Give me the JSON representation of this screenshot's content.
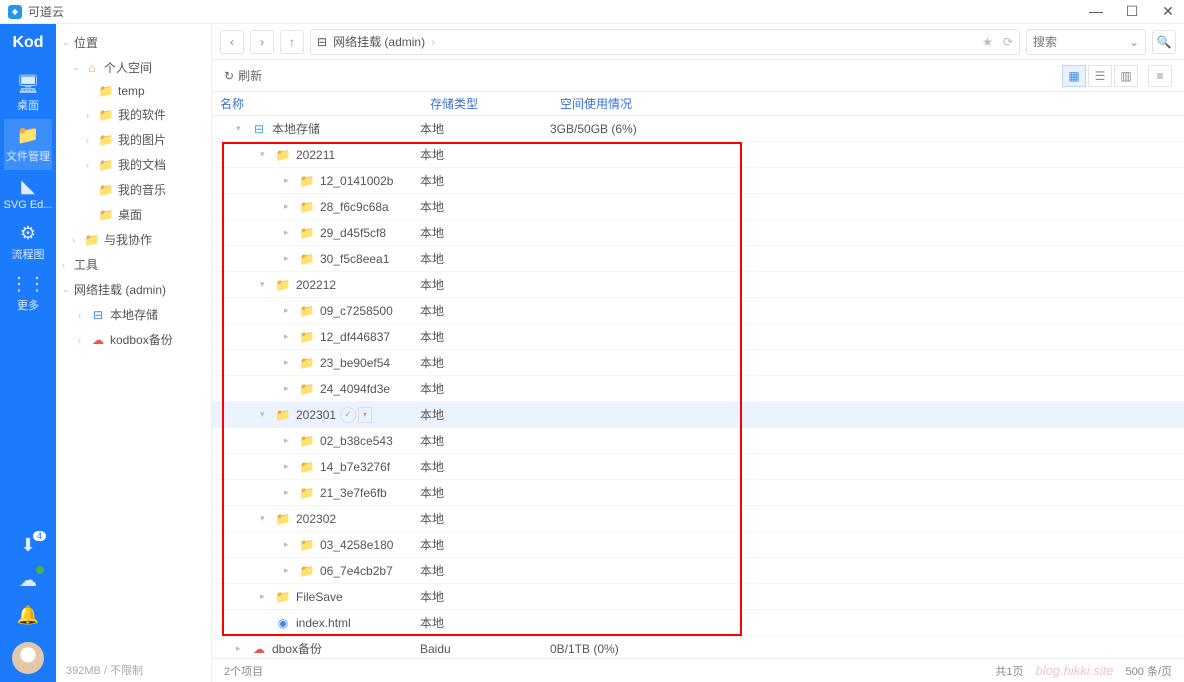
{
  "titlebar": {
    "title": "可道云"
  },
  "rail": {
    "logo": "Kod",
    "items": [
      {
        "label": "桌面",
        "icon": "🖥"
      },
      {
        "label": "文件管理",
        "icon": "📁",
        "active": true
      },
      {
        "label": "SVG Ed...",
        "icon": "◣"
      },
      {
        "label": "流程图",
        "icon": "⚙"
      },
      {
        "label": "更多",
        "icon": "⋮⋮"
      }
    ],
    "download_badge": "4"
  },
  "tree": {
    "root": "位置",
    "personal": "个人空间",
    "personal_items": [
      {
        "label": "temp"
      },
      {
        "label": "我的软件",
        "expandable": true
      },
      {
        "label": "我的图片",
        "expandable": true
      },
      {
        "label": "我的文档",
        "expandable": true
      },
      {
        "label": "我的音乐"
      },
      {
        "label": "桌面"
      }
    ],
    "collab": "与我协作",
    "tools": "工具",
    "netmount": "网络挂载 (admin)",
    "localstore": "本地存储",
    "kodbox": "kodbox备份",
    "footer": "392MB / 不限制"
  },
  "toolbar": {
    "breadcrumb_icon_label": "网络挂载 (admin)",
    "search_placeholder": "搜索",
    "refresh": "刷新"
  },
  "columns": {
    "name": "名称",
    "type": "存储类型",
    "usage": "空间使用情况"
  },
  "rows": [
    {
      "depth": 0,
      "arrow": "down",
      "icon": "drive",
      "name": "本地存储",
      "type": "本地",
      "usage": "3GB/50GB (6%)"
    },
    {
      "depth": 1,
      "arrow": "down",
      "icon": "folder",
      "name": "202211",
      "type": "本地",
      "usage": ""
    },
    {
      "depth": 2,
      "arrow": "right",
      "icon": "folder",
      "name": "12_0141002b",
      "type": "本地",
      "usage": ""
    },
    {
      "depth": 2,
      "arrow": "right",
      "icon": "folder",
      "name": "28_f6c9c68a",
      "type": "本地",
      "usage": ""
    },
    {
      "depth": 2,
      "arrow": "right",
      "icon": "folder",
      "name": "29_d45f5cf8",
      "type": "本地",
      "usage": ""
    },
    {
      "depth": 2,
      "arrow": "right",
      "icon": "folder",
      "name": "30_f5c8eea1",
      "type": "本地",
      "usage": ""
    },
    {
      "depth": 1,
      "arrow": "down",
      "icon": "folder",
      "name": "202212",
      "type": "本地",
      "usage": ""
    },
    {
      "depth": 2,
      "arrow": "right",
      "icon": "folder",
      "name": "09_c7258500",
      "type": "本地",
      "usage": ""
    },
    {
      "depth": 2,
      "arrow": "right",
      "icon": "folder",
      "name": "12_df446837",
      "type": "本地",
      "usage": ""
    },
    {
      "depth": 2,
      "arrow": "right",
      "icon": "folder",
      "name": "23_be90ef54",
      "type": "本地",
      "usage": ""
    },
    {
      "depth": 2,
      "arrow": "right",
      "icon": "folder",
      "name": "24_4094fd3e",
      "type": "本地",
      "usage": ""
    },
    {
      "depth": 1,
      "arrow": "down",
      "icon": "folder",
      "name": "202301",
      "type": "本地",
      "usage": "",
      "selected": true,
      "controls": true
    },
    {
      "depth": 2,
      "arrow": "right",
      "icon": "folder",
      "name": "02_b38ce543",
      "type": "本地",
      "usage": ""
    },
    {
      "depth": 2,
      "arrow": "right",
      "icon": "folder",
      "name": "14_b7e3276f",
      "type": "本地",
      "usage": ""
    },
    {
      "depth": 2,
      "arrow": "right",
      "icon": "folder",
      "name": "21_3e7fe6fb",
      "type": "本地",
      "usage": ""
    },
    {
      "depth": 1,
      "arrow": "down",
      "icon": "folder",
      "name": "202302",
      "type": "本地",
      "usage": ""
    },
    {
      "depth": 2,
      "arrow": "right",
      "icon": "folder",
      "name": "03_4258e180",
      "type": "本地",
      "usage": ""
    },
    {
      "depth": 2,
      "arrow": "right",
      "icon": "folder",
      "name": "06_7e4cb2b7",
      "type": "本地",
      "usage": ""
    },
    {
      "depth": 1,
      "arrow": "right",
      "icon": "folder",
      "name": "FileSave",
      "type": "本地",
      "usage": ""
    },
    {
      "depth": 1,
      "arrow": "none",
      "icon": "chrome",
      "name": "index.html",
      "type": "本地",
      "usage": ""
    },
    {
      "depth": 0,
      "arrow": "right",
      "icon": "baidu",
      "name": "dbox备份",
      "type": "Baidu",
      "usage": "0B/1TB (0%)"
    }
  ],
  "statusbar": {
    "items": "2个项目",
    "page": "共1页",
    "perpage": "500 条/页",
    "watermark": "blog.hikki.site"
  }
}
